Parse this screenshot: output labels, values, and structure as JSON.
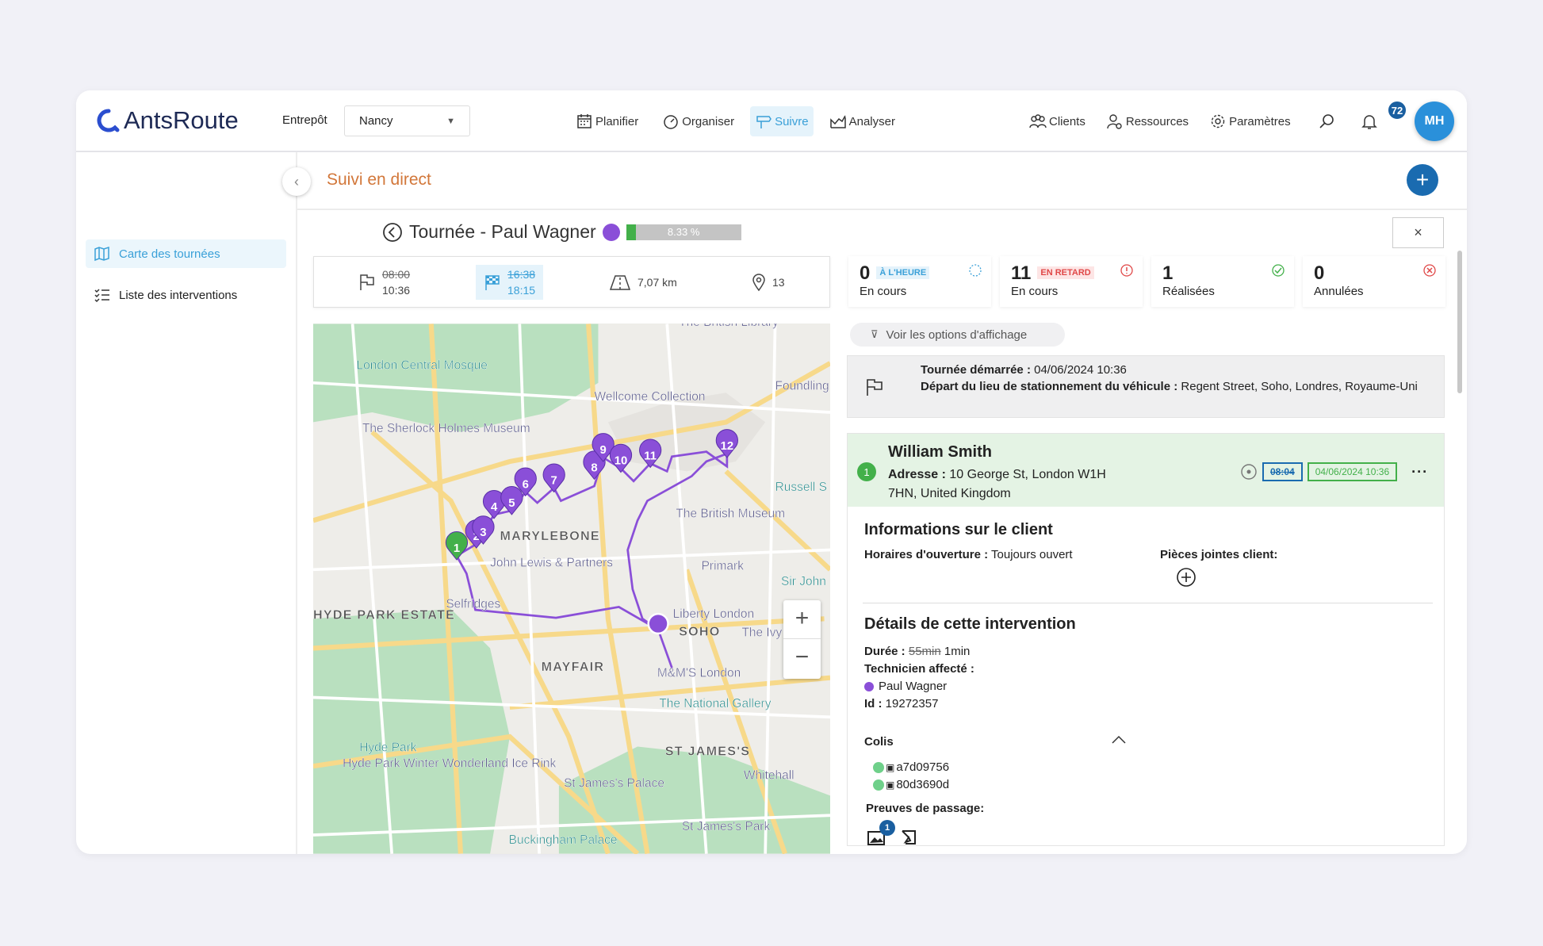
{
  "header": {
    "logo": "AntsRoute",
    "warehouse_label": "Entrepôt",
    "warehouse_value": "Nancy",
    "nav": [
      {
        "label": "Planifier",
        "icon": "calendar-icon"
      },
      {
        "label": "Organiser",
        "icon": "gauge-icon"
      },
      {
        "label": "Suivre",
        "icon": "signpost-icon",
        "active": true
      },
      {
        "label": "Analyser",
        "icon": "chart-icon"
      }
    ],
    "right_nav": [
      {
        "label": "Clients",
        "icon": "users-icon"
      },
      {
        "label": "Ressources",
        "icon": "resource-icon"
      },
      {
        "label": "Paramètres",
        "icon": "gear-icon"
      }
    ],
    "notifications": "72",
    "avatar": "MH"
  },
  "sidebar": {
    "items": [
      {
        "label": "Carte des tournées",
        "icon": "map-icon",
        "active": true
      },
      {
        "label": "Liste des interventions",
        "icon": "list-icon"
      }
    ]
  },
  "page": {
    "title": "Suivi en direct",
    "tour_title": "Tournée - Paul Wagner",
    "progress_label": "8.33 %",
    "progress": 8.33,
    "driver_color": "#8a4fd8",
    "close": "×"
  },
  "stats": {
    "start_planned": "08:00",
    "start_actual": "10:36",
    "end_planned": "16:38",
    "end_actual": "18:15",
    "distance": "7,07 km",
    "stops": "13"
  },
  "status_cards": [
    {
      "count": "0",
      "tag": "À L'HEURE",
      "label": "En cours",
      "color": "#3aa0d8"
    },
    {
      "count": "11",
      "tag": "EN RETARD",
      "label": "En cours",
      "color": "#e04848"
    },
    {
      "count": "1",
      "tag": "",
      "label": "Réalisées",
      "color": "#43b04a"
    },
    {
      "count": "0",
      "tag": "",
      "label": "Annulées",
      "color": "#e04848"
    }
  ],
  "map": {
    "markers": [
      "1",
      "2",
      "3",
      "4",
      "5",
      "6",
      "7",
      "8",
      "9",
      "10",
      "11",
      "12"
    ],
    "labels": [
      "London Central Mosque",
      "Wellcome Collection",
      "The Sherlock Holmes Museum",
      "MARYLEBONE",
      "John Lewis & Partners",
      "Selfridges",
      "HYDE PARK ESTATE",
      "Primark",
      "Liberty London",
      "SOHO",
      "MAYFAIR",
      "M&M'S London",
      "The National Gallery",
      "The British Museum",
      "ST JAMES'S",
      "Hyde Park",
      "Hyde Park Winter Wonderland Ice Rink",
      "St James's Palace",
      "Buckingham Palace",
      "St James's Park",
      "Whitehall",
      "Russell S",
      "Foundling",
      "The Ivy",
      "Sir John",
      "The British Library"
    ],
    "zoom_in": "+",
    "zoom_out": "−"
  },
  "display_options": "Voir les options d'affichage",
  "start": {
    "l1_label": "Tournée démarrée :",
    "l1_value": "04/06/2024 10:36",
    "l2_label": "Départ du lieu de stationnement du véhicule :",
    "l2_value": "Regent Street, Soho, Londres, Royaume-Uni"
  },
  "intervention": {
    "number": "1",
    "name": "William Smith",
    "address_label": "Adresse :",
    "address": "10 George St, London W1H 7HN, United Kingdom",
    "planned_time": "08:04",
    "actual_time": "04/06/2024 10:36",
    "client_title": "Informations sur le client",
    "hours_label": "Horaires d'ouverture :",
    "hours": "Toujours ouvert",
    "attachments_label": "Pièces jointes client:",
    "details_title": "Détails de cette intervention",
    "duration_label": "Durée :",
    "duration_planned": "55min",
    "duration_actual": "1min",
    "tech_label": "Technicien affecté :",
    "tech": "Paul Wagner",
    "id_label": "Id :",
    "id": "19272357",
    "colis_label": "Colis",
    "colis": [
      "a7d09756",
      "80d3690d"
    ],
    "proofs_label": "Preuves de passage:",
    "proof_count": "1"
  }
}
